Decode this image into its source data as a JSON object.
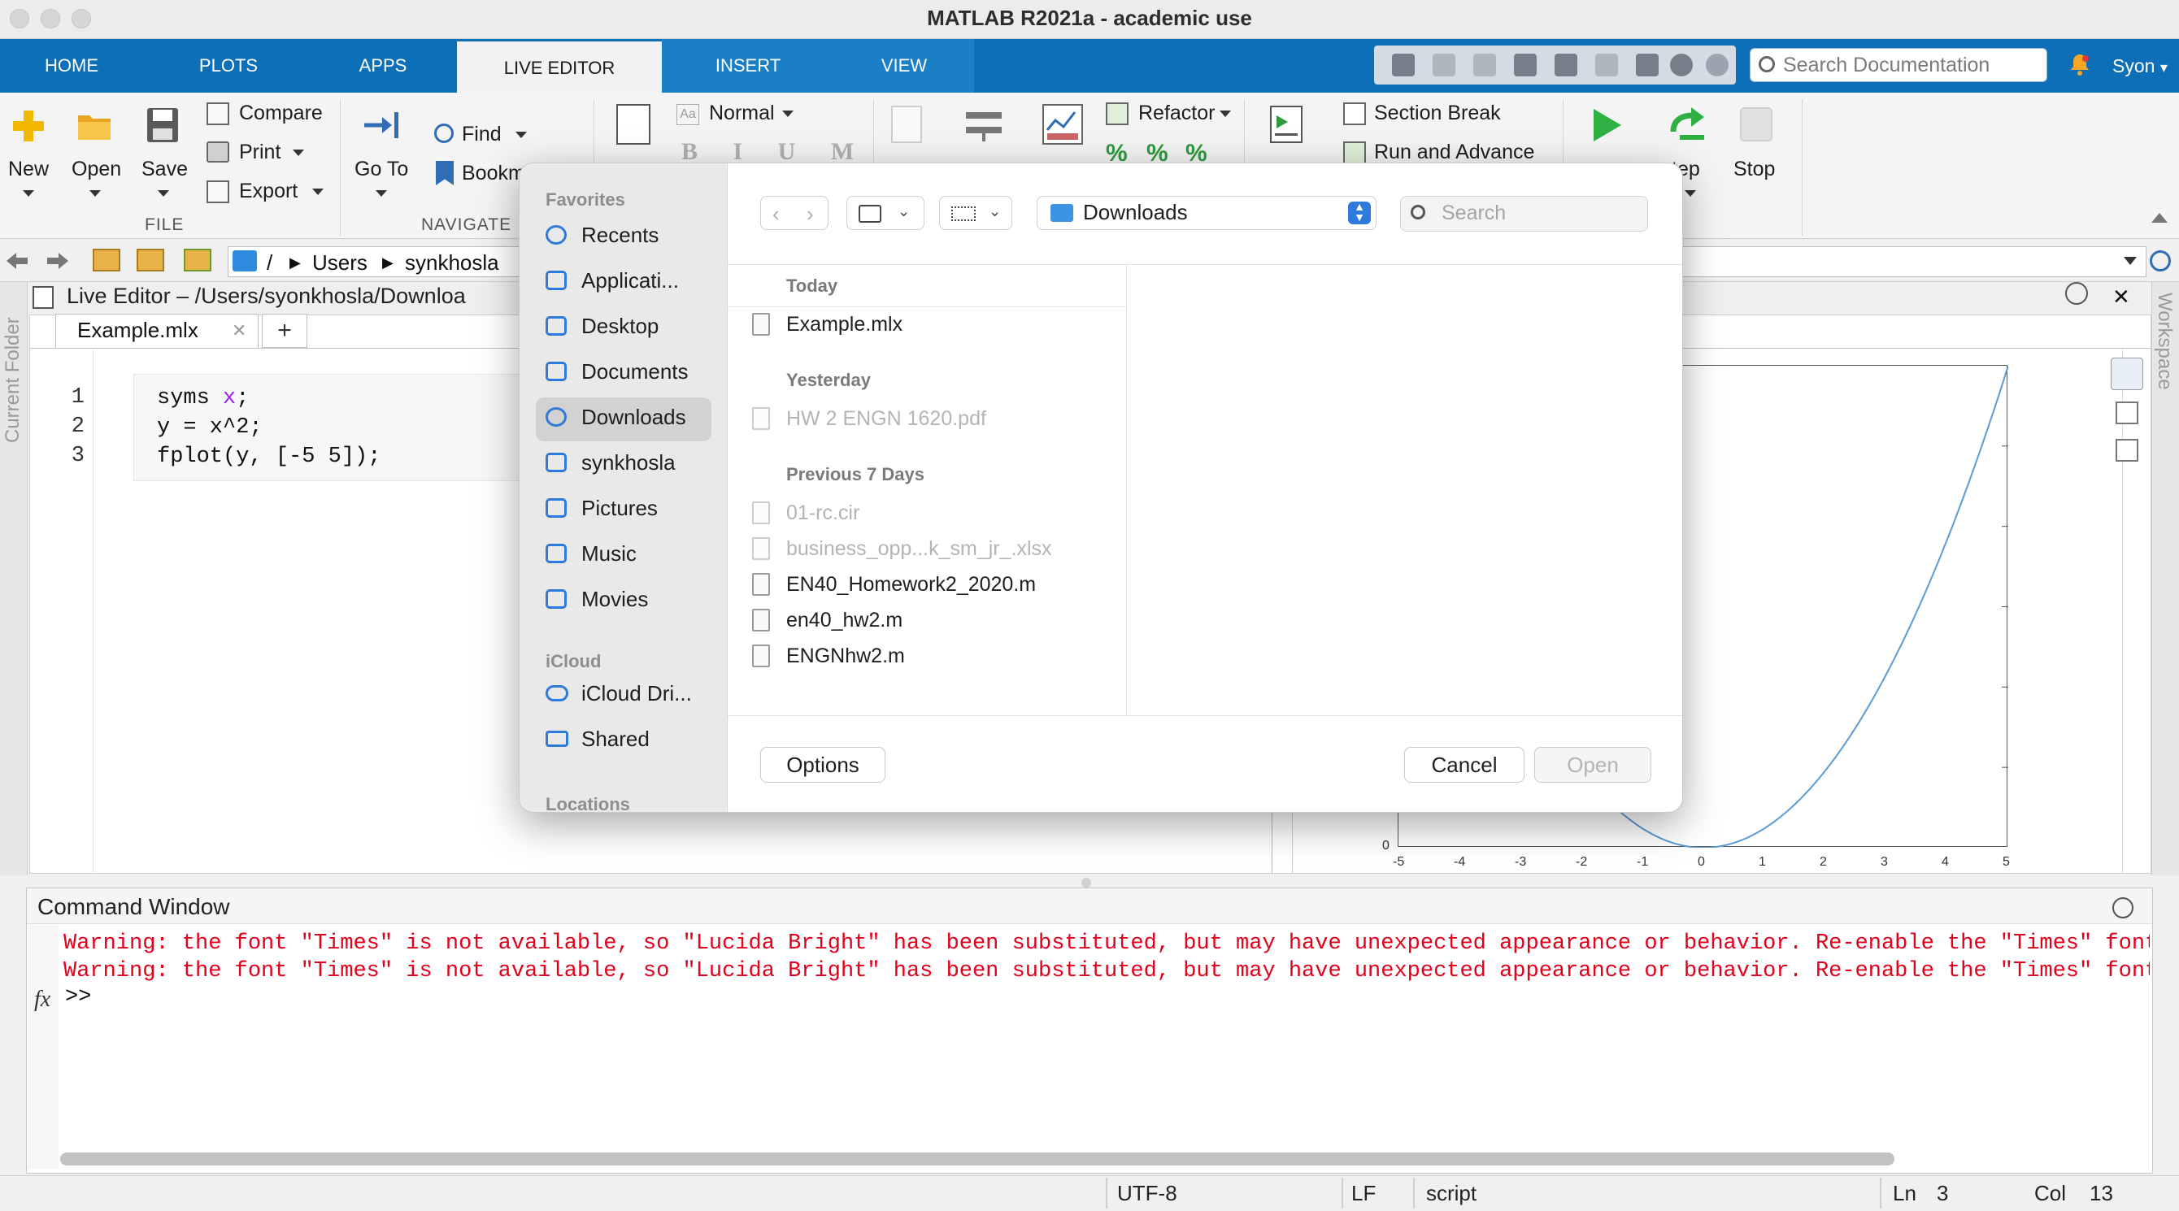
{
  "window": {
    "title": "MATLAB R2021a - academic use"
  },
  "tabs": [
    "HOME",
    "PLOTS",
    "APPS",
    "LIVE EDITOR",
    "INSERT",
    "VIEW"
  ],
  "search_documentation": {
    "placeholder": "Search Documentation"
  },
  "user": {
    "name": "Syon"
  },
  "ribbon": {
    "file": {
      "new": "New",
      "open": "Open",
      "save": "Save",
      "compare": "Compare",
      "print": "Print",
      "export": "Export",
      "group": "FILE"
    },
    "navigate": {
      "go_to": "Go To",
      "find": "Find",
      "bookmark": "Bookm",
      "group": "NAVIGATE"
    },
    "text": {
      "style": "Normal",
      "font_buttons": "B I U M"
    },
    "code": {
      "refactor": "Refactor",
      "percent": "%"
    },
    "section": {
      "section_break": "Section Break",
      "run_and_advance": "Run and Advance"
    },
    "run": {
      "step": "tep",
      "stop": "Stop"
    }
  },
  "address": {
    "segments": [
      "/",
      "Users",
      "synkhosla"
    ]
  },
  "left_panel": {
    "label": "Current Folder"
  },
  "right_panel": {
    "label": "Workspace"
  },
  "editor": {
    "title": "Live Editor – /Users/syonkhosla/Downloa",
    "file_tab": "Example.mlx",
    "close_glyph": "✕",
    "add_tab": "+",
    "line_numbers": [
      "1",
      "2",
      "3"
    ],
    "code": [
      {
        "text": "syms ",
        "var": "x",
        "rest": ";"
      },
      {
        "text": "y = x^2;"
      },
      {
        "text": "fplot(y, [-5 5]);"
      }
    ]
  },
  "plot": {
    "x_ticks": [
      "-5",
      "-4",
      "-3",
      "-2",
      "-1",
      "0",
      "1",
      "2",
      "3",
      "4",
      "5"
    ],
    "y_zero_label": "0"
  },
  "chart_data": {
    "type": "line",
    "x": [
      -5,
      -4,
      -3,
      -2,
      -1,
      0,
      1,
      2,
      3,
      4,
      5
    ],
    "series": [
      {
        "values": [
          25,
          16,
          9,
          4,
          1,
          0,
          1,
          4,
          9,
          16,
          25
        ]
      }
    ],
    "xlim": [
      -5,
      5
    ],
    "ylim": [
      0,
      25
    ],
    "grid": false
  },
  "dialog": {
    "sidebar": {
      "favorites_heading": "Favorites",
      "favorites": [
        "Recents",
        "Applicati...",
        "Desktop",
        "Documents",
        "Downloads",
        "synkhosla",
        "Pictures",
        "Music",
        "Movies"
      ],
      "icloud_heading": "iCloud",
      "icloud": [
        "iCloud Dri...",
        "Shared"
      ],
      "locations_heading": "Locations"
    },
    "location": "Downloads",
    "search": {
      "placeholder": "Search"
    },
    "groups": [
      {
        "label": "Today",
        "files": [
          {
            "name": "Example.mlx",
            "dim": false
          }
        ]
      },
      {
        "label": "Yesterday",
        "files": [
          {
            "name": "HW 2 ENGN 1620.pdf",
            "dim": true
          }
        ]
      },
      {
        "label": "Previous 7 Days",
        "files": [
          {
            "name": "01-rc.cir",
            "dim": true
          },
          {
            "name": "business_opp...k_sm_jr_.xlsx",
            "dim": true
          },
          {
            "name": "EN40_Homework2_2020.m",
            "dim": false
          },
          {
            "name": "en40_hw2.m",
            "dim": false
          },
          {
            "name": "ENGNhw2.m",
            "dim": false
          }
        ]
      }
    ],
    "options": "Options",
    "cancel": "Cancel",
    "open": "Open"
  },
  "command_window": {
    "title": "Command Window",
    "warnings": [
      "Warning: the font \"Times\" is not available, so \"Lucida Bright\" has been substituted, but may have unexpected appearance or behavior. Re-enable the \"Times\" font to",
      "Warning: the font \"Times\" is not available, so \"Lucida Bright\" has been substituted, but may have unexpected appearance or behavior. Re-enable the \"Times\" font to"
    ],
    "fx": "fx",
    "prompt": ">>"
  },
  "status": {
    "encoding": "UTF-8",
    "eol": "LF",
    "type": "script",
    "ln_label": "Ln",
    "ln": "3",
    "col_label": "Col",
    "col": "13"
  },
  "colors": {
    "accent_blue": "#0d6fb7",
    "warning_red": "#e3001b",
    "plot_line": "#5b9bd5",
    "syms_var": "#a020f0"
  }
}
